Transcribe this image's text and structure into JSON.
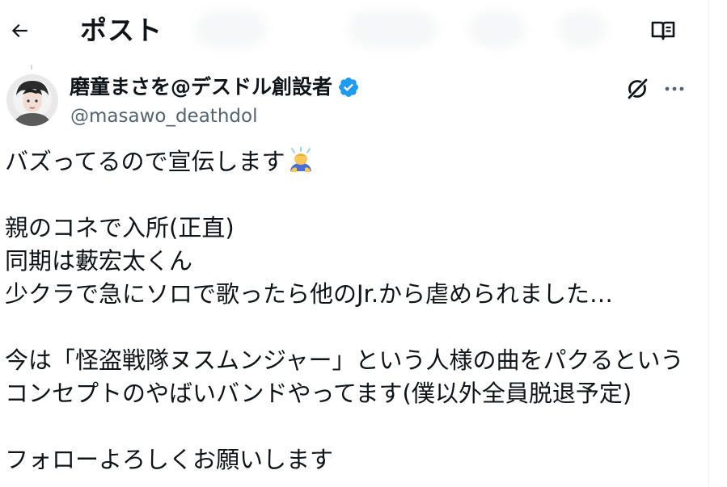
{
  "header": {
    "back_icon": "arrow-left-icon",
    "title": "ポスト",
    "reader_icon": "open-book-icon"
  },
  "author": {
    "display_name": "磨童まさを@デスドル創設者",
    "handle": "@masawo_deathdol",
    "verified_icon": "verified-badge-icon",
    "verified_color": "#1d9bf0",
    "avatar_icon": "avatar-photo"
  },
  "actions": {
    "grok_icon": "grok-icon",
    "more_icon": "more-dots-icon"
  },
  "tweet": {
    "lines": [
      "バズってるので宣伝します",
      "",
      "親のコネで入所(正直)",
      "同期は藪宏太くん",
      "少クラで急にソロで歌ったら他のJr.から虐められました…",
      "",
      "今は「怪盗戦隊ヌスムンジャー」という人様の曲をパクるという",
      "コンセプトのやばいバンドやってます(僕以外全員脱退予定)",
      "",
      "フォローよろしくお願いします"
    ],
    "emoji_icon": "person-bowing-emoji"
  },
  "colors": {
    "text": "#0f1419",
    "secondary_text": "#536471",
    "divider": "#eff3f4"
  }
}
